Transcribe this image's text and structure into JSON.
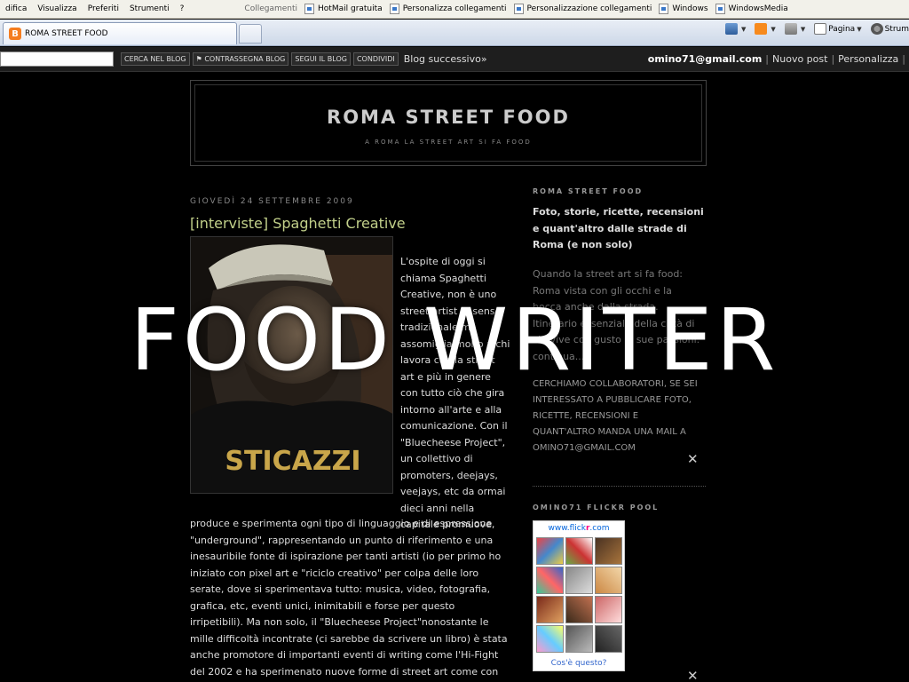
{
  "browser": {
    "menu_items": [
      "difica",
      "Visualizza",
      "Preferiti",
      "Strumenti",
      "?"
    ],
    "links_label": "Collegamenti",
    "links": [
      "HotMail gratuita",
      "Personalizza collegamenti",
      "Personalizzazione collegamenti",
      "Windows",
      "WindowsMedia"
    ],
    "tab_title": "ROMA STREET FOOD",
    "commands": {
      "page": "Pagina",
      "tools": "Strum"
    }
  },
  "navbar": {
    "search_placeholder": "",
    "buttons": [
      "CERCA NEL BLOG",
      "⚑ CONTRASSEGNA BLOG",
      "SEGUI IL BLOG",
      "CONDIVIDI"
    ],
    "next_blog": "Blog successivo»",
    "email": "omino71@gmail.com",
    "new_post": "Nuovo post",
    "customize": "Personalizza"
  },
  "blog": {
    "title": "ROMA STREET FOOD",
    "description": "A ROMA LA STREET ART SI FA FOOD"
  },
  "post": {
    "date": "GIOVEDÌ 24 SETTEMBRE 2009",
    "title": "[interviste] Spaghetti Creative",
    "shirt_text": "STICAZZI",
    "body_right": "L'ospite di oggi si chiama Spaghetti Creative, non è uno street artist in senso tradizionale ma assomiglia molto a chi lavora con la street art e più in genere con tutto ciò che gira intorno all'arte e alla comunicazione. Con il \"Bluecheese Project\", un collettivo di promoters, deejays, veejays, etc da ormai dieci anni nella capitale promuove,",
    "body_full": "produce e sperimenta ogni tipo di linguaggio e di espressione \"underground\", rappresentando un punto di riferimento e una inesauribile fonte di ispirazione per tanti artisti (io per primo ho iniziato con pixel art e \"riciclo creativo\" per colpa delle loro serate, dove si sperimentava tutto: musica, video, fotografia, grafica, etc, eventi unici, inimitabili e forse per questo irripetibili). Ma non solo, il \"Bluecheese Project\"nonostante le mille difficoltà incontrate (ci sarebbe da scrivere un libro) è stata anche promotore di importanti eventi di writing come l'Hi-Fight del 2002 e ha sperimenato nuove forme di street art come con la"
  },
  "sidebar": {
    "heading1": "ROMA STREET FOOD",
    "description": "Foto, storie, ricette, recensioni e quant'altro dalle strade di Roma (e non solo)",
    "about": "Quando la street art si fa food: Roma vista con gli occhi e la bocca anche dalla strada. Itinerario essenziale della città di chi vive con gusto le sue passioni. continua...",
    "collab": "CERCHIAMO COLLABORATORI, SE SEI INTERESSATO A PUBBLICARE FOTO, RICETTE, RECENSIONI E QUANT'ALTRO MANDA UNA MAIL A OMINO71@GMAIL.COM",
    "heading2": "OMINO71 FLICKR POOL",
    "flickr_logo_www": "www.",
    "flickr_logo_flick": "flick",
    "flickr_logo_r": "r",
    "flickr_logo_com": ".com",
    "flickr_what": "Cos'è questo?"
  },
  "overlay": {
    "title": "FOOD WRITER"
  },
  "colors": {
    "background": "#000000",
    "post_title": "#c2d08a",
    "overlay_text": "#ffffff"
  },
  "icons": [
    "blogger-icon",
    "home-icon",
    "rss-icon",
    "print-icon",
    "page-icon",
    "tools-icon",
    "wrench-icon"
  ]
}
